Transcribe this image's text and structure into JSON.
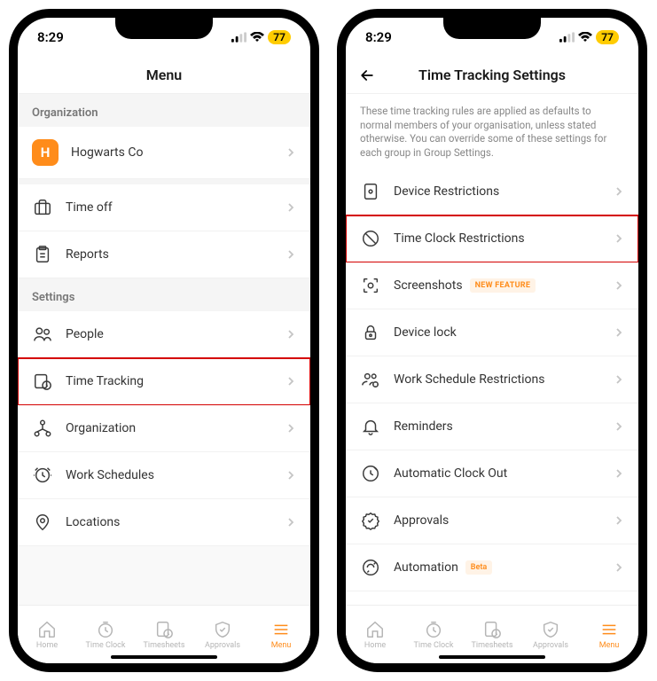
{
  "status": {
    "time": "8:29",
    "battery": "77"
  },
  "screen1": {
    "title": "Menu",
    "sections": {
      "org_header": "Organization",
      "settings_header": "Settings"
    },
    "org": {
      "initial": "H",
      "name": "Hogwarts Co"
    },
    "items": {
      "timeoff": "Time off",
      "reports": "Reports",
      "people": "People",
      "timetracking": "Time Tracking",
      "organization": "Organization",
      "workschedules": "Work Schedules",
      "locations": "Locations"
    }
  },
  "screen2": {
    "title": "Time Tracking Settings",
    "description": "These time tracking rules are applied as defaults to normal members of your organisation, unless stated otherwise. You can override some of these settings for each group in Group Settings.",
    "items": {
      "device_restrictions": "Device Restrictions",
      "time_clock_restrictions": "Time Clock Restrictions",
      "screenshots": "Screenshots",
      "device_lock": "Device lock",
      "work_schedule_restrictions": "Work Schedule Restrictions",
      "reminders": "Reminders",
      "auto_clock_out": "Automatic Clock Out",
      "approvals": "Approvals",
      "automation": "Automation"
    },
    "badges": {
      "new_feature": "NEW FEATURE",
      "beta": "Beta"
    }
  },
  "tabs": {
    "home": "Home",
    "timeclock": "Time Clock",
    "timesheets": "Timesheets",
    "approvals": "Approvals",
    "menu": "Menu"
  }
}
